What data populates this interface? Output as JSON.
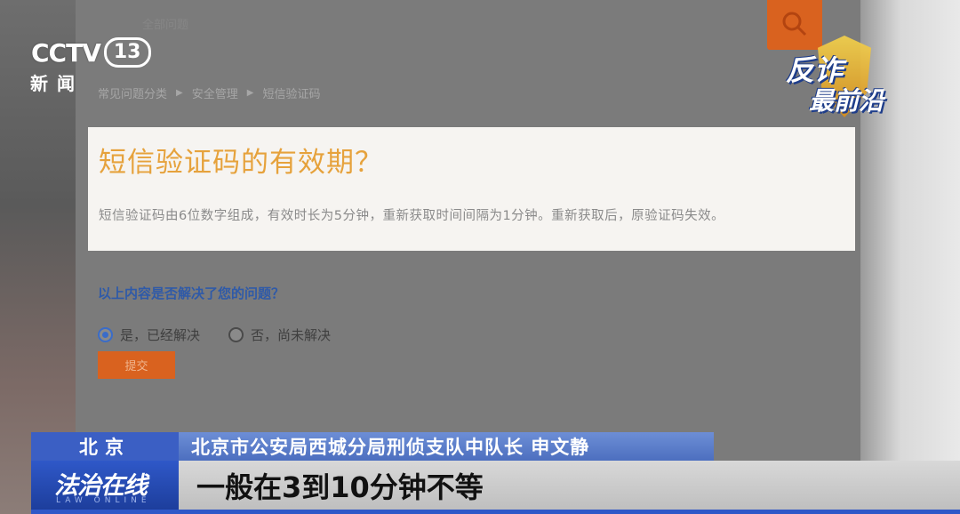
{
  "broadcast": {
    "channel_word": "CCTV",
    "channel_number": "13",
    "channel_subtitle": "新闻",
    "program_logo_line1": "反诈",
    "program_logo_line2": "最前沿"
  },
  "webpage": {
    "top_faded_text": "全部问题",
    "breadcrumb": [
      "常见问题分类",
      "安全管理",
      "短信验证码"
    ],
    "faq": {
      "title": "短信验证码的有效期？",
      "body": "短信验证码由6位数字组成，有效时长为5分钟，重新获取时间间隔为1分钟。重新获取后，原验证码失效。"
    },
    "feedback": {
      "question": "以上内容是否解决了您的问题？",
      "options": [
        {
          "label": "是，已经解决",
          "selected": true
        },
        {
          "label": "否，尚未解决",
          "selected": false
        }
      ],
      "submit_label": "提交"
    }
  },
  "lower_third": {
    "location": "北京",
    "program_name": "法治在线",
    "program_name_en": "LAW ONLINE",
    "speaker": "北京市公安局西城分局刑侦支队中队长 申文静",
    "subtitle": "一般在3到10分钟不等"
  },
  "colors": {
    "accent_orange": "#d9621f",
    "title_orange": "#e6a23c",
    "link_blue": "#2f5aa8",
    "bar_blue": "#3b5fc4"
  }
}
